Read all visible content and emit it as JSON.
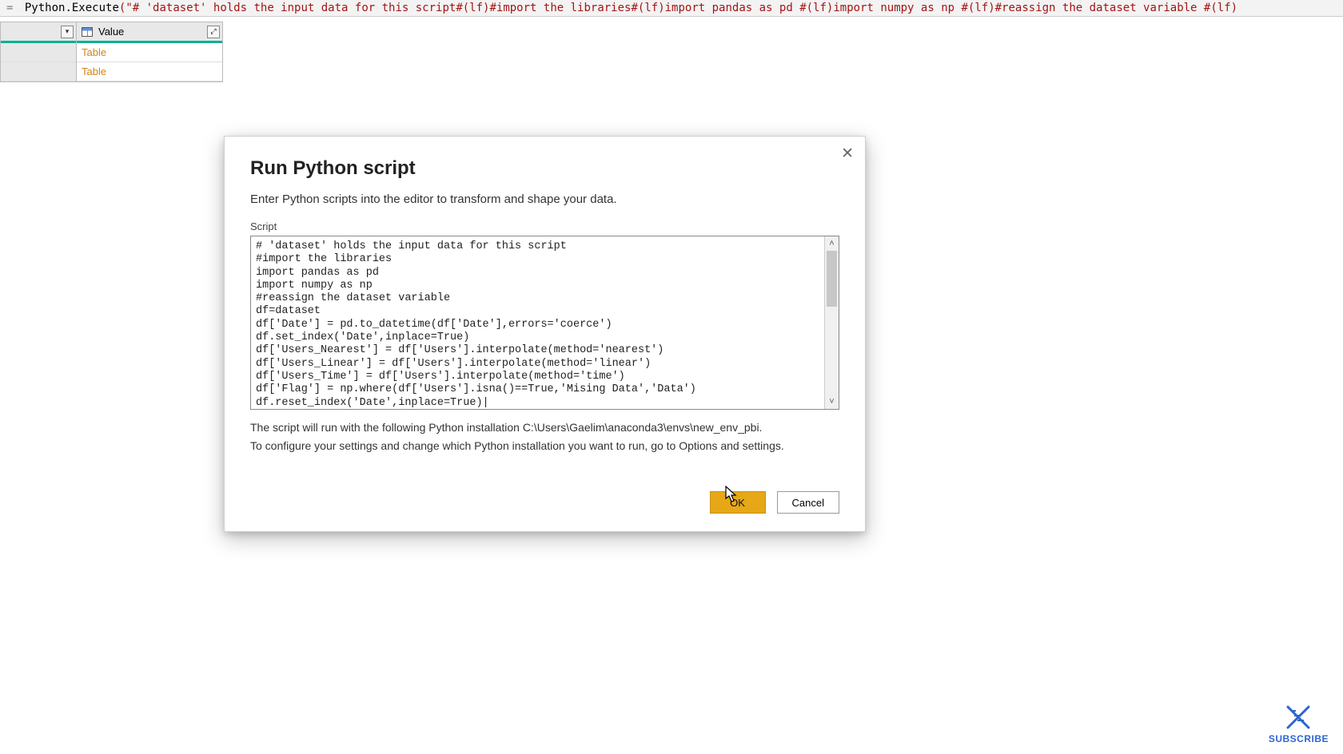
{
  "formula_bar": {
    "prefix": "=",
    "func": "Python.Execute",
    "arg": "(\"# 'dataset' holds the input data for this script#(lf)#import the libraries#(lf)import pandas as pd #(lf)import numpy as np #(lf)#reassign the dataset variable #(lf)"
  },
  "table": {
    "column_header": "Value",
    "rows": [
      "Table",
      "Table"
    ]
  },
  "dialog": {
    "title": "Run Python script",
    "subtitle": "Enter Python scripts into the editor to transform and shape your data.",
    "script_label": "Script",
    "script_value": "# 'dataset' holds the input data for this script\n#import the libraries\nimport pandas as pd\nimport numpy as np\n#reassign the dataset variable\ndf=dataset\ndf['Date'] = pd.to_datetime(df['Date'],errors='coerce')\ndf.set_index('Date',inplace=True)\ndf['Users_Nearest'] = df['Users'].interpolate(method='nearest')\ndf['Users_Linear'] = df['Users'].interpolate(method='linear')\ndf['Users_Time'] = df['Users'].interpolate(method='time')\ndf['Flag'] = np.where(df['Users'].isna()==True,'Mising Data','Data')\ndf.reset_index('Date',inplace=True)|",
    "info_line1": "The script will run with the following Python installation C:\\Users\\Gaelim\\anaconda3\\envs\\new_env_pbi.",
    "info_line2": "To configure your settings and change which Python installation you want to run, go to Options and settings.",
    "ok_label": "OK",
    "cancel_label": "Cancel"
  },
  "subscribe_label": "SUBSCRIBE"
}
